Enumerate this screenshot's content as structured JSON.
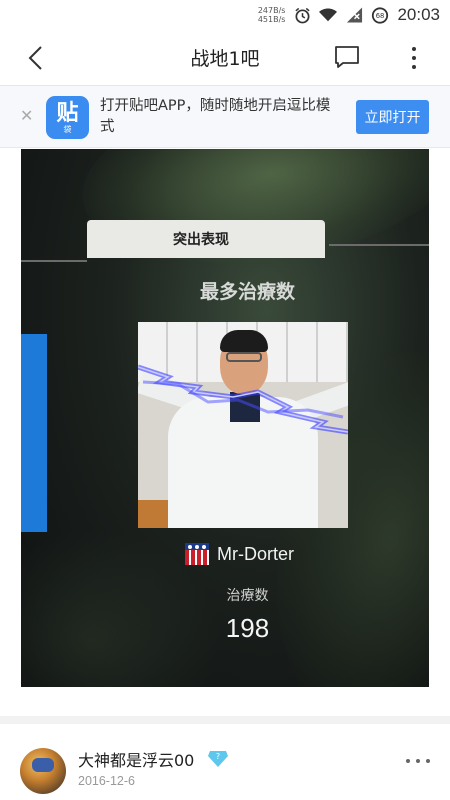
{
  "status_bar": {
    "net_up": "247B/s",
    "net_down": "451B/s",
    "battery_level": "68",
    "time": "20:03"
  },
  "nav": {
    "title": "战地1吧",
    "back_icon": "chevron-left-icon",
    "comment_icon": "comment-icon",
    "more_icon": "more-vertical-icon"
  },
  "banner": {
    "logo_text": "贴",
    "logo_subtext": "袋",
    "message": "打开贴吧APP，随时随地开启逗比模式",
    "button_label": "立即打开",
    "close_icon": "close-icon",
    "accent_color": "#3d8ef0"
  },
  "post_image": {
    "tab_label": "突出表现",
    "award_title": "最多治療数",
    "player_name": "Mr-Dorter",
    "stat_label": "治療数",
    "stat_value": "198"
  },
  "reply": {
    "username": "大神都是浮云00",
    "date": "2016-12-6",
    "badge_icon": "diamond-badge-icon",
    "more_icon": "more-horizontal-icon"
  }
}
